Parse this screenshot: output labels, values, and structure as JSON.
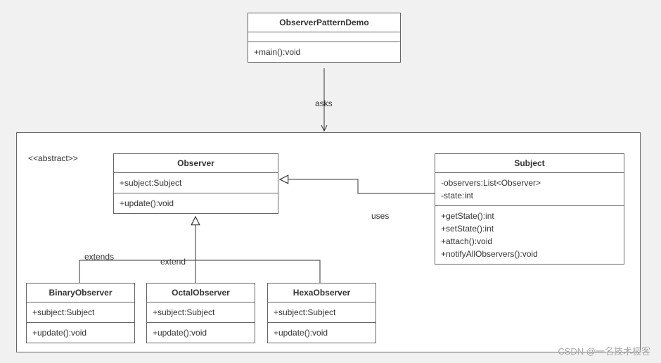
{
  "stereotype": "<<abstract>>",
  "relations": {
    "asks": "asks",
    "uses": "uses",
    "extends": "extends",
    "extend": "extend"
  },
  "watermark": "CSDN @一名技术极客",
  "classes": {
    "demo": {
      "name": "ObserverPatternDemo",
      "methods": [
        "+main():void"
      ]
    },
    "observer": {
      "name": "Observer",
      "attrs": [
        "+subject:Subject"
      ],
      "methods": [
        "+update():void"
      ]
    },
    "subject": {
      "name": "Subject",
      "attrs": [
        "-observers:List<Observer>",
        "-state:int"
      ],
      "methods": [
        "+getState():int",
        "+setState():int",
        "+attach():void",
        "+notifyAllObservers():void"
      ]
    },
    "binary": {
      "name": "BinaryObserver",
      "attrs": [
        "+subject:Subject"
      ],
      "methods": [
        "+update():void"
      ]
    },
    "octal": {
      "name": "OctalObserver",
      "attrs": [
        "+subject:Subject"
      ],
      "methods": [
        "+update():void"
      ]
    },
    "hexa": {
      "name": "HexaObserver",
      "attrs": [
        "+subject:Subject"
      ],
      "methods": [
        "+update():void"
      ]
    }
  }
}
